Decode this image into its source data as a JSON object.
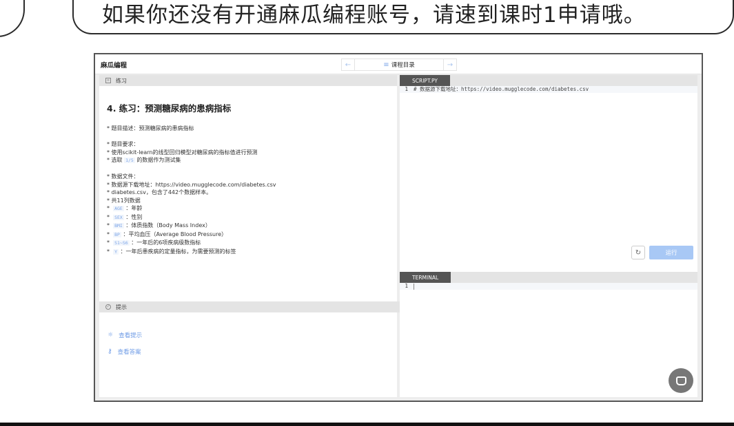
{
  "banner": {
    "text": "如果你还没有开通麻瓜编程账号，请速到课时1申请哦。"
  },
  "app": {
    "brand": "麻瓜编程",
    "nav": {
      "prev_icon": "arrow-left-icon",
      "menu_icon": "list-icon",
      "label": "课程目录",
      "next_icon": "arrow-right-icon"
    }
  },
  "exercise": {
    "section_label": "练习",
    "title": "4. 练习：预测糖尿病的患病指标",
    "desc_line": "* 题目描述：预测糖尿病的患病指标",
    "req_title": "* 题目要求：",
    "req1": "* 使用scikit-learn的线型回归模型对糖尿病的指标值进行预测",
    "req2_pre": "* 选取",
    "req2_code": "1/5",
    "req2_post": "的数据作为测试集",
    "data_title": "* 数据文件：",
    "data_url": "* 数据源下载地址：https://video.mugglecode.com/diabetes.csv",
    "data_count": "* diabetes.csv，包含了442个数据样本。",
    "data_cols": "* 共11列数据",
    "cols": [
      {
        "code": "AGE",
        "text": "：年龄"
      },
      {
        "code": "SEX",
        "text": "：性别"
      },
      {
        "code": "BMI",
        "text": "：体质指数（Body Mass Index）"
      },
      {
        "code": "BP",
        "text": "：平均血压（Average Blood Pressure）"
      },
      {
        "code": "S1~S6",
        "text": "：一年后的6项疾病级数指标"
      },
      {
        "code": "Y",
        "text": "：一年后患疾病的定量指标，为需要预测的标签"
      }
    ]
  },
  "hints": {
    "section_label": "提示",
    "view_hint": "查看提示",
    "view_answer": "查看答案"
  },
  "editor": {
    "tab": "SCRIPT.PY",
    "line_no": "1",
    "line_text": "# 数据源下载地址：https://video.mugglecode.com/diabetes.csv",
    "run_label": "运行"
  },
  "terminal": {
    "tab": "TERMINAL",
    "line_no": "1"
  }
}
